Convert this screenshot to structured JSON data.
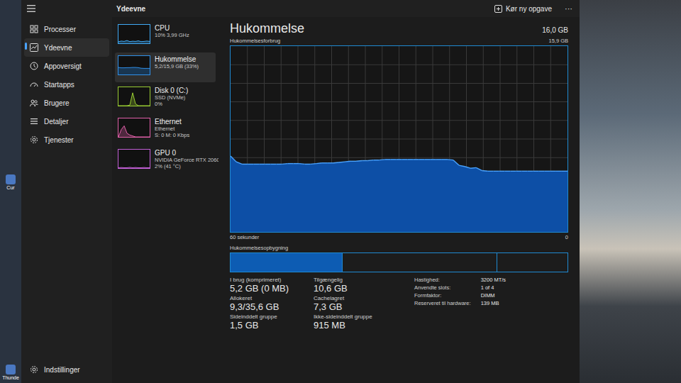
{
  "window": {
    "title": "Ydeevne"
  },
  "toolbar": {
    "run_task": "Kør ny opgave",
    "more": "···"
  },
  "desktop_icons": [
    {
      "label": "Cur"
    },
    {
      "label": "Thunde"
    }
  ],
  "sidebar": {
    "items": [
      {
        "label": "Processer",
        "kind": "processes",
        "selected": false
      },
      {
        "label": "Ydeevne",
        "kind": "performance",
        "selected": true
      },
      {
        "label": "Appoversigt",
        "kind": "history",
        "selected": false
      },
      {
        "label": "Startapps",
        "kind": "startup",
        "selected": false
      },
      {
        "label": "Brugere",
        "kind": "users",
        "selected": false
      },
      {
        "label": "Detaljer",
        "kind": "details",
        "selected": false
      },
      {
        "label": "Tjenester",
        "kind": "services",
        "selected": false
      }
    ],
    "footer": "Indstillinger"
  },
  "devices": [
    {
      "name": "CPU",
      "lines": [
        "10% 3,99 GHz"
      ],
      "selected": false,
      "color": "#3fa9f5",
      "values": [
        8,
        12,
        10,
        15,
        9,
        11,
        10,
        13,
        9,
        10,
        12,
        10
      ]
    },
    {
      "name": "Hukommelse",
      "lines": [
        "5,2/15,9 GB (33%)"
      ],
      "selected": true,
      "color": "#2f8fe8",
      "values": [
        38,
        36,
        36,
        37,
        37,
        38,
        38,
        37,
        34,
        33,
        33,
        33
      ]
    },
    {
      "name": "Disk 0 (C:)",
      "lines": [
        "SSD (NVMe)",
        "0%"
      ],
      "selected": false,
      "color": "#9acd32",
      "values": [
        0,
        0,
        0,
        0,
        3,
        70,
        10,
        0,
        0,
        0,
        0,
        0
      ]
    },
    {
      "name": "Ethernet",
      "lines": [
        "Ethernet",
        "S: 0 M: 0 Kbps"
      ],
      "selected": false,
      "color": "#e05fa8",
      "values": [
        0,
        40,
        60,
        20,
        10,
        5,
        0,
        0,
        0,
        0,
        0,
        0
      ]
    },
    {
      "name": "GPU 0",
      "lines": [
        "NVIDIA GeForce RTX 2060",
        "2% (41 °C)"
      ],
      "selected": false,
      "color": "#c25fd6",
      "values": [
        2,
        3,
        2,
        2,
        4,
        2,
        3,
        2,
        2,
        3,
        2,
        2
      ]
    }
  ],
  "panel": {
    "title": "Hukommelse",
    "total": "16,0 GB",
    "chart": {
      "label": "Hukommelsesforbrug",
      "max_label": "15,9 GB",
      "max": 15.9,
      "time_label": "60 sekunder",
      "zero_label": "0",
      "values": [
        6.5,
        6.0,
        5.8,
        5.8,
        5.8,
        5.8,
        5.8,
        5.8,
        5.8,
        5.8,
        5.85,
        5.85,
        5.85,
        5.8,
        5.8,
        5.85,
        5.9,
        5.9,
        5.9,
        5.95,
        6.0,
        6.05,
        6.05,
        6.1,
        6.1,
        6.15,
        6.15,
        6.2,
        6.2,
        6.2,
        6.2,
        6.2,
        6.2,
        6.2,
        6.2,
        6.2,
        6.2,
        6.2,
        6.2,
        6.15,
        5.7,
        5.6,
        5.45,
        5.5,
        5.25,
        5.2,
        5.2,
        5.2,
        5.2,
        5.2,
        5.2,
        5.2,
        5.2,
        5.2,
        5.2,
        5.2,
        5.2,
        5.2,
        5.2,
        5.2
      ]
    },
    "composition": {
      "label": "Hukommelsesopbygning",
      "segments": [
        {
          "kind": "in-use",
          "level": 0.33
        },
        {
          "kind": "standby",
          "level": 0.46
        },
        {
          "kind": "free",
          "level": 0.21
        }
      ]
    },
    "stats": [
      {
        "label": "I brug (komprimeret)",
        "value": "5,2 GB (0 MB)"
      },
      {
        "label": "Tilgængelig",
        "value": "10,6 GB"
      },
      {
        "label": "Allokeret",
        "value": "9,3/35,6 GB"
      },
      {
        "label": "Cachelagret",
        "value": "7,3 GB"
      },
      {
        "label": "Sideinddelt gruppe",
        "value": "1,5 GB"
      },
      {
        "label": "Ikke-sideinddelt gruppe",
        "value": "915 MB"
      }
    ],
    "specs": [
      {
        "label": "Hastighed:",
        "value": "3200 MT/s"
      },
      {
        "label": "Anvendte slots:",
        "value": "1 of 4"
      },
      {
        "label": "Formfaktor:",
        "value": "DIMM"
      },
      {
        "label": "Reserveret til hardware:",
        "value": "139 MB"
      }
    ]
  }
}
